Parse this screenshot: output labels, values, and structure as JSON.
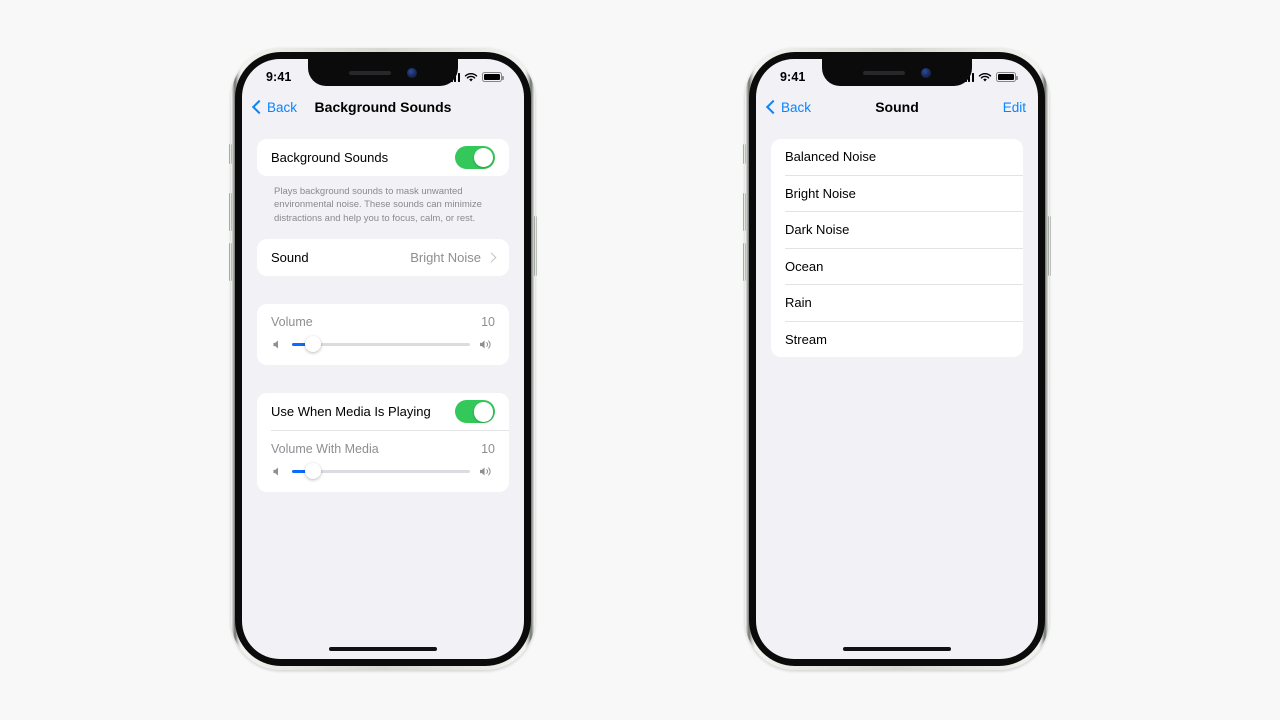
{
  "page": {
    "background": "#f8f8f8"
  },
  "colors": {
    "accent_blue": "#0a84ff",
    "toggle_green": "#34c759",
    "slider_blue": "#0a6cff",
    "screen_background": "#f1f1f6",
    "card_white": "#ffffff",
    "secondary_text": "#8e8e93"
  },
  "phones": [
    {
      "id": "background-sounds-screen",
      "status_bar": {
        "time": "9:41",
        "cellular_icon": "cellular-bars-icon",
        "wifi_icon": "wifi-icon",
        "battery_icon": "battery-full-icon"
      },
      "nav": {
        "back_label": "Back",
        "title": "Background Sounds",
        "back_icon": "chevron-left-icon"
      },
      "sections": [
        {
          "type": "toggle",
          "label": "Background Sounds",
          "toggle_on": true,
          "footnote": "Plays background sounds to mask unwanted environmental noise. These sounds can minimize distractions and help you to focus, calm, or rest."
        },
        {
          "type": "disclosure",
          "label": "Sound",
          "value": "Bright Noise",
          "chevron_icon": "chevron-right-icon"
        },
        {
          "type": "slider",
          "label": "Volume",
          "value": "10",
          "fill_percent": 12,
          "left_icon": "speaker-low-icon",
          "right_icon": "speaker-high-icon"
        },
        {
          "type": "toggle-slider",
          "toggle_label": "Use When Media Is Playing",
          "toggle_on": true,
          "slider_label": "Volume With Media",
          "slider_value": "10",
          "fill_percent": 12,
          "left_icon": "speaker-low-icon",
          "right_icon": "speaker-high-icon"
        }
      ],
      "home_indicator": "home-indicator"
    },
    {
      "id": "sound-list-screen",
      "status_bar": {
        "time": "9:41",
        "cellular_icon": "cellular-bars-icon",
        "wifi_icon": "wifi-icon",
        "battery_icon": "battery-full-icon"
      },
      "nav": {
        "back_label": "Back",
        "title": "Sound",
        "edit_label": "Edit",
        "back_icon": "chevron-left-icon"
      },
      "list": [
        "Balanced Noise",
        "Bright Noise",
        "Dark Noise",
        "Ocean",
        "Rain",
        "Stream"
      ],
      "home_indicator": "home-indicator"
    }
  ]
}
